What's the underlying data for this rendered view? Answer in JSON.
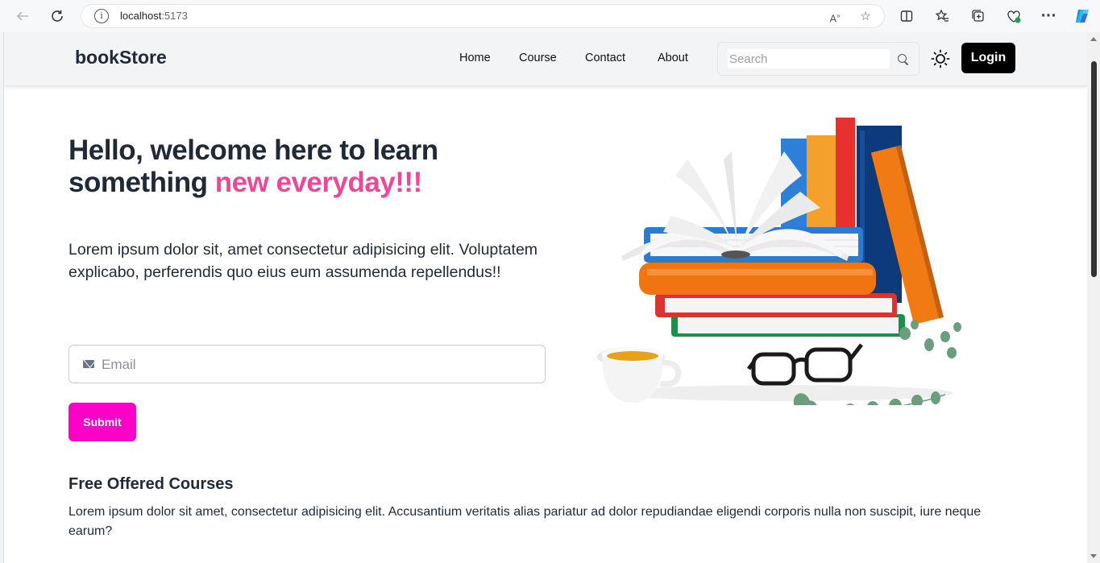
{
  "browser": {
    "url_host": "localhost",
    "url_port": ":5173"
  },
  "navbar": {
    "brand": "bookStore",
    "links": [
      "Home",
      "Course",
      "Contact",
      "About"
    ],
    "search_placeholder": "Search",
    "login_label": "Login"
  },
  "hero": {
    "title_part1": "Hello, welcome here to learn something ",
    "title_accent": "new everyday!!!",
    "description": "Lorem ipsum dolor sit, amet consectetur adipisicing elit. Voluptatem explicabo, perferendis quo eius eum assumenda repellendus!!",
    "email_placeholder": "Email",
    "submit_label": "Submit"
  },
  "courses": {
    "title": "Free Offered Courses",
    "description": "Lorem ipsum dolor sit amet, consectetur adipisicing elit. Accusantium veritatis alias pariatur ad dolor repudiandae eligendi corporis nulla non suscipit, iure neque earum?"
  },
  "colors": {
    "accent": "#ec4899",
    "submit": "#ff00c8",
    "login_bg": "#000000",
    "text_dark": "#1f2937"
  },
  "icons": [
    "back-arrow-icon",
    "reload-icon",
    "info-icon",
    "read-aloud-icon",
    "star-icon",
    "split-screen-icon",
    "favorites-icon",
    "collections-icon",
    "browser-essentials-icon",
    "more-icon",
    "copilot-icon",
    "search-icon",
    "sun-icon",
    "mail-icon"
  ]
}
